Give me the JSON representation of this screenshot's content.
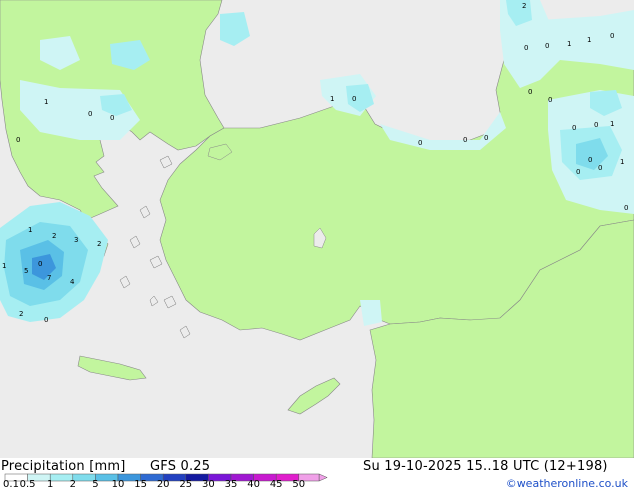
{
  "footer": {
    "title_label": "Precipitation [mm]",
    "model": "GFS 0.25",
    "valid_time": "Su 19-10-2025 15..18 UTC (12+198)",
    "credit": "©weatheronline.co.uk"
  },
  "legend": {
    "ticks": [
      "0.1",
      "0.5",
      "1",
      "2",
      "5",
      "10",
      "15",
      "20",
      "25",
      "30",
      "35",
      "40",
      "45",
      "50"
    ],
    "colors": [
      "#ffffff",
      "#cff5f5",
      "#a6eef2",
      "#7fdcec",
      "#5ac0e6",
      "#3c96dc",
      "#2e6ad2",
      "#2240c0",
      "#141aa0",
      "#7a16d8",
      "#a018d2",
      "#c81ad0",
      "#e01ecc",
      "#f0a0e8"
    ]
  },
  "map": {
    "land_color": "#c2f59e",
    "sea_color": "#ececec",
    "precip_labels": [
      "2",
      "0",
      "0",
      "1",
      "1",
      "0",
      "0",
      "1",
      "0",
      "0",
      "0",
      "1",
      "0",
      "0",
      "0",
      "0",
      "0",
      "0",
      "1",
      "0",
      "0",
      "1",
      "0",
      "0",
      "0",
      "1",
      "2",
      "3",
      "2",
      "1",
      "5",
      "7",
      "4",
      "2",
      "0",
      "0"
    ]
  }
}
